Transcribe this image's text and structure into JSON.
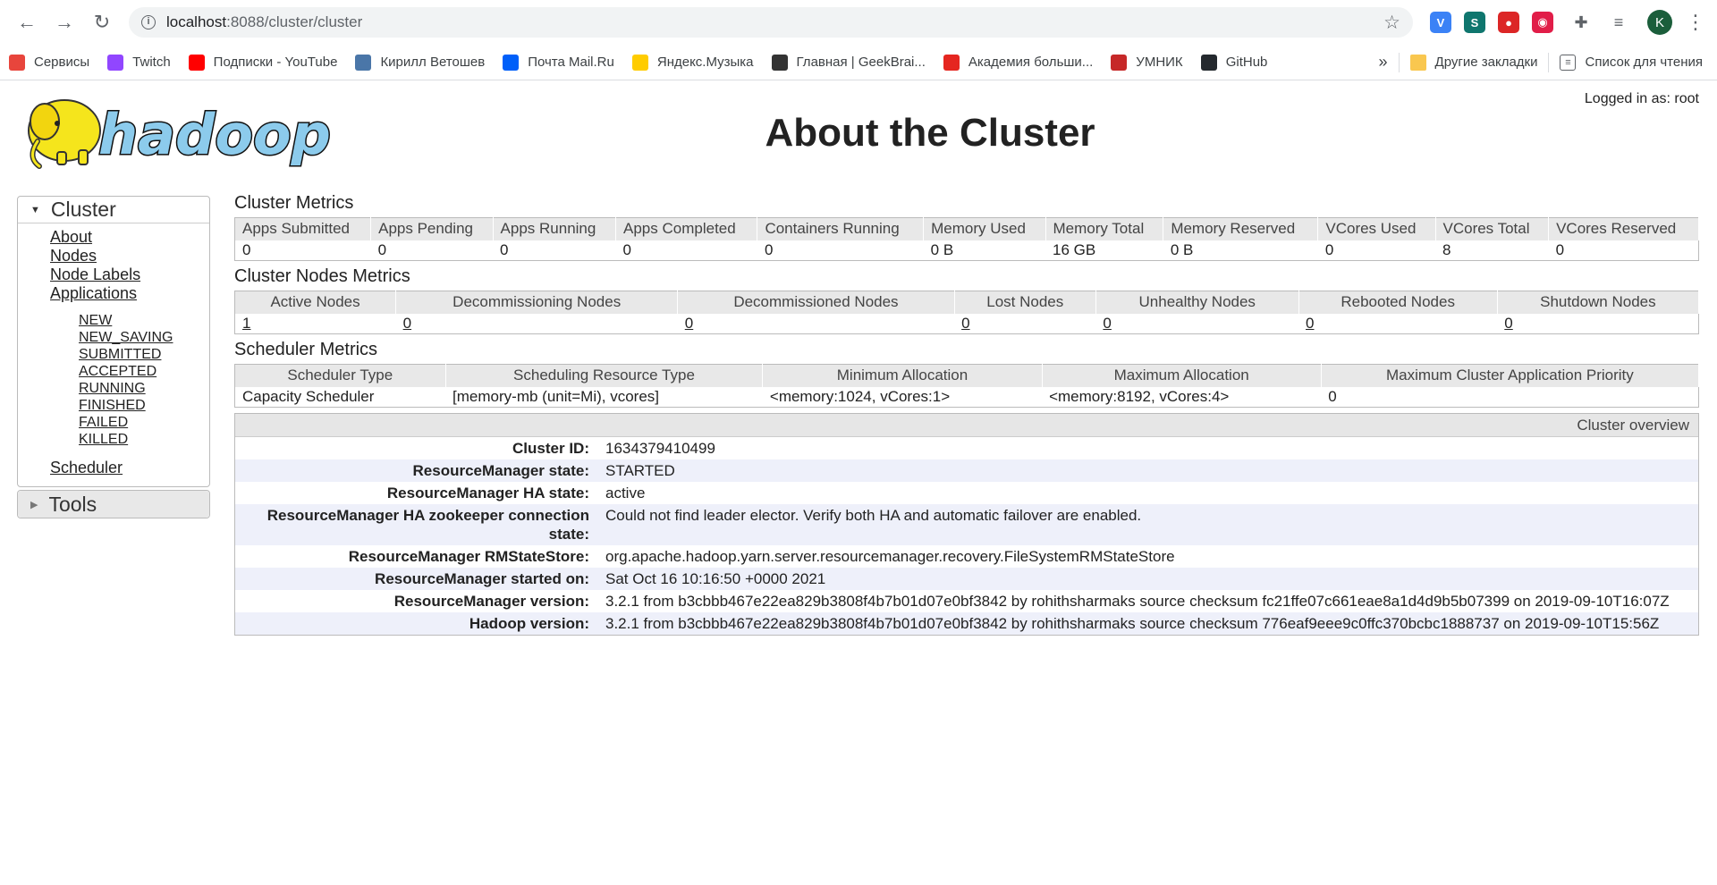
{
  "browser": {
    "url_host": "localhost",
    "url_path": ":8088/cluster/cluster",
    "avatar_letter": "K",
    "extensions": [
      {
        "name": "v-extension-icon",
        "color": "#3b82f6",
        "glyph": "V"
      },
      {
        "name": "s-extension-icon",
        "color": "#0f766e",
        "glyph": "S"
      },
      {
        "name": "opera-extension-icon",
        "color": "#dc2626",
        "glyph": "●"
      },
      {
        "name": "red-extension-icon",
        "color": "#e11d48",
        "glyph": "◉"
      }
    ]
  },
  "bookmarks": [
    {
      "label": "Сервисы",
      "icon": "apps-grid-icon",
      "color": "#e8453c"
    },
    {
      "label": "Twitch",
      "icon": "twitch-icon",
      "color": "#9146ff"
    },
    {
      "label": "Подписки - YouTube",
      "icon": "youtube-icon",
      "color": "#ff0000"
    },
    {
      "label": "Кирилл Ветошев",
      "icon": "vk-icon",
      "color": "#4a76a8"
    },
    {
      "label": "Почта Mail.Ru",
      "icon": "mail-icon",
      "color": "#005ff9"
    },
    {
      "label": "Яндекс.Музыка",
      "icon": "music-icon",
      "color": "#ffcc00"
    },
    {
      "label": "Главная | GeekBrai...",
      "icon": "geekbrains-icon",
      "color": "#333333"
    },
    {
      "label": "Академия больши...",
      "icon": "academy-icon",
      "color": "#e52620"
    },
    {
      "label": "УМНИК",
      "icon": "umnik-icon",
      "color": "#c62828"
    },
    {
      "label": "GitHub",
      "icon": "github-icon",
      "color": "#24292e"
    }
  ],
  "bookmarks_right": {
    "more": "»",
    "other": "Другие закладки",
    "reading_list": "Список для чтения"
  },
  "page": {
    "logged_in": "Logged in as: root",
    "title": "About the Cluster",
    "logo_text": "hadoop"
  },
  "sidebar": {
    "cluster_label": "Cluster",
    "links": [
      "About",
      "Nodes",
      "Node Labels",
      "Applications"
    ],
    "app_states": [
      "NEW",
      "NEW_SAVING",
      "SUBMITTED",
      "ACCEPTED",
      "RUNNING",
      "FINISHED",
      "FAILED",
      "KILLED"
    ],
    "scheduler": "Scheduler",
    "tools_label": "Tools"
  },
  "cluster_metrics": {
    "title": "Cluster Metrics",
    "headers": [
      "Apps Submitted",
      "Apps Pending",
      "Apps Running",
      "Apps Completed",
      "Containers Running",
      "Memory Used",
      "Memory Total",
      "Memory Reserved",
      "VCores Used",
      "VCores Total",
      "VCores Reserved"
    ],
    "values": [
      "0",
      "0",
      "0",
      "0",
      "0",
      "0 B",
      "16 GB",
      "0 B",
      "0",
      "8",
      "0"
    ]
  },
  "node_metrics": {
    "title": "Cluster Nodes Metrics",
    "headers": [
      "Active Nodes",
      "Decommissioning Nodes",
      "Decommissioned Nodes",
      "Lost Nodes",
      "Unhealthy Nodes",
      "Rebooted Nodes",
      "Shutdown Nodes"
    ],
    "values": [
      "1",
      "0",
      "0",
      "0",
      "0",
      "0",
      "0"
    ]
  },
  "scheduler_metrics": {
    "title": "Scheduler Metrics",
    "headers": [
      "Scheduler Type",
      "Scheduling Resource Type",
      "Minimum Allocation",
      "Maximum Allocation",
      "Maximum Cluster Application Priority"
    ],
    "values": [
      "Capacity Scheduler",
      "[memory-mb (unit=Mi), vcores]",
      "<memory:1024, vCores:1>",
      "<memory:8192, vCores:4>",
      "0"
    ]
  },
  "overview": {
    "header": "Cluster overview",
    "rows": [
      {
        "label": "Cluster ID:",
        "value": "1634379410499"
      },
      {
        "label": "ResourceManager state:",
        "value": "STARTED"
      },
      {
        "label": "ResourceManager HA state:",
        "value": "active"
      },
      {
        "label": "ResourceManager HA zookeeper connection state:",
        "value": "Could not find leader elector. Verify both HA and automatic failover are enabled."
      },
      {
        "label": "ResourceManager RMStateStore:",
        "value": "org.apache.hadoop.yarn.server.resourcemanager.recovery.FileSystemRMStateStore"
      },
      {
        "label": "ResourceManager started on:",
        "value": "Sat Oct 16 10:16:50 +0000 2021"
      },
      {
        "label": "ResourceManager version:",
        "value": "3.2.1 from b3cbbb467e22ea829b3808f4b7b01d07e0bf3842 by rohithsharmaks source checksum fc21ffe07c661eae8a1d4d9b5b07399 on 2019-09-10T16:07Z"
      },
      {
        "label": "Hadoop version:",
        "value": "3.2.1 from b3cbbb467e22ea829b3808f4b7b01d07e0bf3842 by rohithsharmaks source checksum 776eaf9eee9c0ffc370bcbc1888737 on 2019-09-10T15:56Z"
      }
    ]
  }
}
